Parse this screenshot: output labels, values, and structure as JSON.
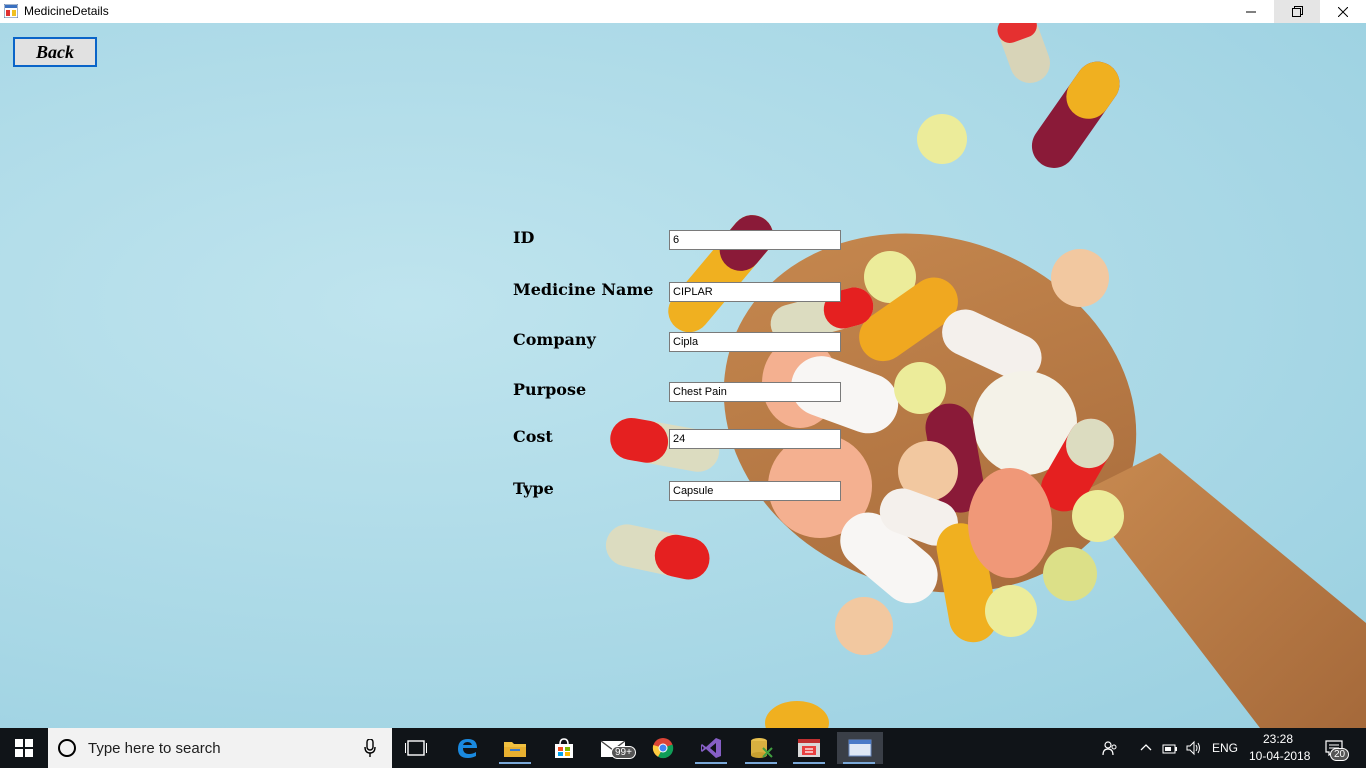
{
  "window": {
    "title": "MedicineDetails",
    "minimize_icon": "minimize-icon",
    "restore_icon": "restore-icon",
    "close_icon": "close-icon"
  },
  "back_button": {
    "label": "Back"
  },
  "form": {
    "fields": [
      {
        "label": "ID",
        "value": "6"
      },
      {
        "label": "Medicine Name",
        "value": "CIPLAR"
      },
      {
        "label": "Company",
        "value": "Cipla"
      },
      {
        "label": "Purpose",
        "value": "Chest Pain"
      },
      {
        "label": "Cost",
        "value": "24"
      },
      {
        "label": "Type",
        "value": "Capsule"
      }
    ]
  },
  "taskbar": {
    "search_placeholder": "Type here to search",
    "mail_badge": "99+",
    "language": "ENG",
    "time": "23:28",
    "date": "10-04-2018",
    "notification_count": "20"
  },
  "colors": {
    "background": "#a9d8e6",
    "back_border": "#0a64c8",
    "taskbar": "#101418"
  }
}
